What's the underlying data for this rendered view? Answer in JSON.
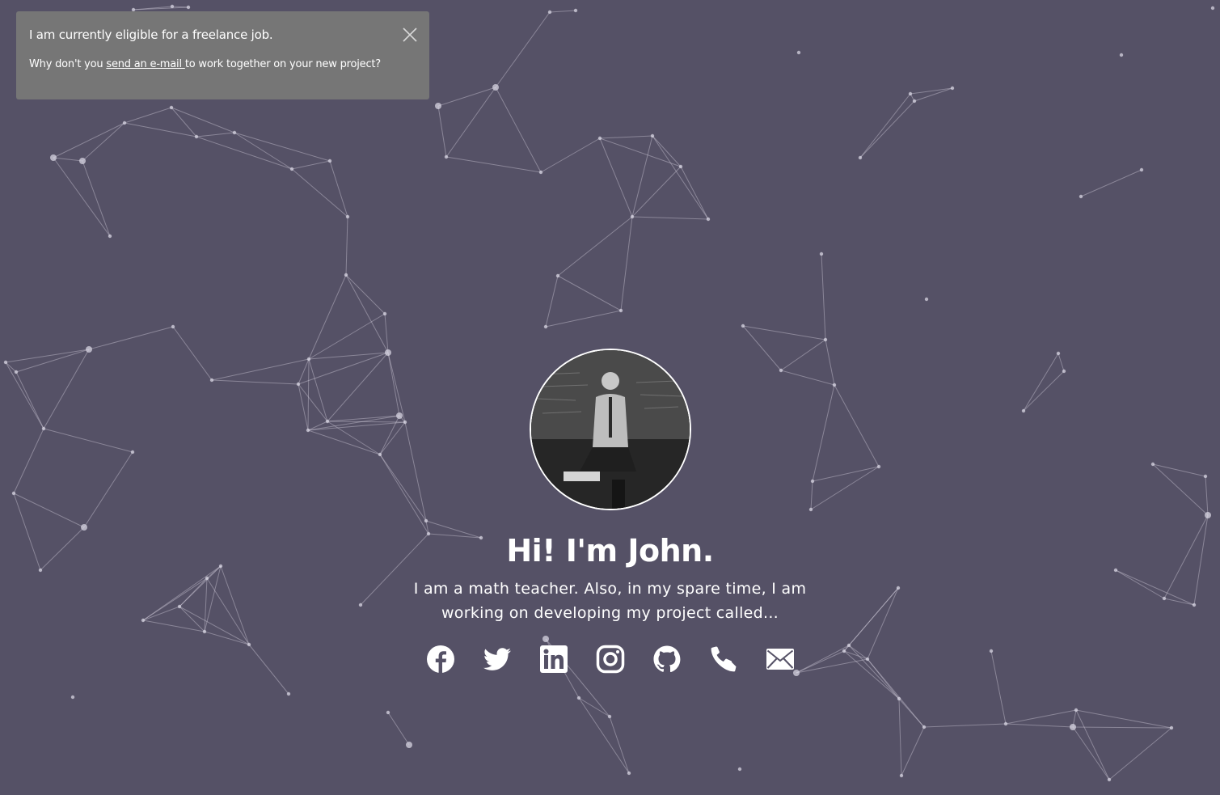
{
  "notice": {
    "title": "I am currently eligible for a freelance job.",
    "body_prefix": "Why don't you ",
    "link_text": "send an e-mail ",
    "body_suffix": "to work together on your new project?",
    "close_icon": "close-icon"
  },
  "hero": {
    "avatar_alt": "Portrait of John",
    "title": "Hi! I'm John.",
    "subtitle": "I am a math teacher. Also, in my spare time, I am working on developing my project called..."
  },
  "socials": [
    {
      "name": "facebook",
      "icon": "facebook-icon"
    },
    {
      "name": "twitter",
      "icon": "twitter-icon"
    },
    {
      "name": "linkedin",
      "icon": "linkedin-icon"
    },
    {
      "name": "instagram",
      "icon": "instagram-icon"
    },
    {
      "name": "github",
      "icon": "github-icon"
    },
    {
      "name": "phone",
      "icon": "phone-icon"
    },
    {
      "name": "email",
      "icon": "envelope-icon"
    }
  ],
  "colors": {
    "background": "#555166",
    "notice_background": "#767676",
    "text": "#ffffff"
  }
}
